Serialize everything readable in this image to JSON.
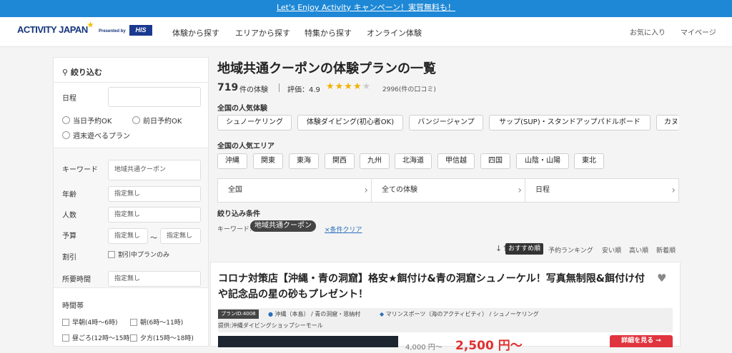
{
  "banner": {
    "text": "Let's Enjoy Activity キャンペーン！実質無料も！"
  },
  "header": {
    "logo": "ACTIVITY JAPAN",
    "presented": "Presented by",
    "his": "HIS",
    "nav": [
      "体験から探す",
      "エリアから探す",
      "特集から探す",
      "オンライン体験"
    ],
    "favorites": "お気に入り",
    "mypage": "マイページ"
  },
  "sidebar": {
    "title": "絞り込む",
    "date_label": "日程",
    "radio": [
      "当日予約OK",
      "前日予約OK",
      "週末遊べるプラン"
    ],
    "keyword_label": "キーワード",
    "keyword_value": "地域共通クーポン",
    "age_label": "年齢",
    "people_label": "人数",
    "budget_label": "予算",
    "placeholder": "指定無し",
    "tilde": "〜",
    "discount_label": "割引",
    "discount_check": "割引中プランのみ",
    "duration_label": "所要時間",
    "time_label": "時間帯",
    "time_opts": [
      "早朝(4時〜6時)",
      "朝(6時〜11時)",
      "昼ごろ(12時〜15時)",
      "夕方(15時〜18時)"
    ]
  },
  "main": {
    "title": "地域共通クーポンの体験プランの一覧",
    "count": "719",
    "count_suffix": "件の体験",
    "rating_label": "評価：4.9",
    "stars_on": "★★★★",
    "stars_off": "★",
    "reviews": "2996(件の口コミ)",
    "popular_label": "全国の人気体験",
    "popular": [
      "シュノーケリング",
      "体験ダイビング(初心者OK)",
      "バンジージャンプ",
      "サップ(SUP)・スタンドアップパドルボード",
      "カヌ"
    ],
    "area_label": "全国の人気エリア",
    "areas": [
      "沖縄",
      "関東",
      "東海",
      "関西",
      "九州",
      "北海道",
      "甲信越",
      "四国",
      "山陰・山陽",
      "東北"
    ],
    "dropdowns": [
      "全国",
      "全ての体験",
      "日程"
    ],
    "cond_title": "絞り込み条件",
    "cond_label": "キーワード:",
    "cond_chip": "地域共通クーポン",
    "clear": "×条件クリア",
    "sort_icon": "↓↑",
    "sort": [
      "おすすめ順",
      "予約ランキング",
      "安い順",
      "高い順",
      "新着順"
    ]
  },
  "card": {
    "title": "コロナ対策店【沖縄・青の洞窟】格安★餌付け&青の洞窟シュノーケル！写真無制限&餌付け付や記念品の星の砂もプレゼント！",
    "plan_id": "プランID:4008",
    "location": "沖縄（本島） / 青の洞窟・恩納村",
    "category": "マリンスポーツ（海のアクティビティ） / シュノーケリング",
    "provider": "提供:沖縄ダイビングショップシーモール",
    "price_old": "4,000 円〜",
    "price_new": "2,500 円〜",
    "detail": "詳細を見る →"
  }
}
